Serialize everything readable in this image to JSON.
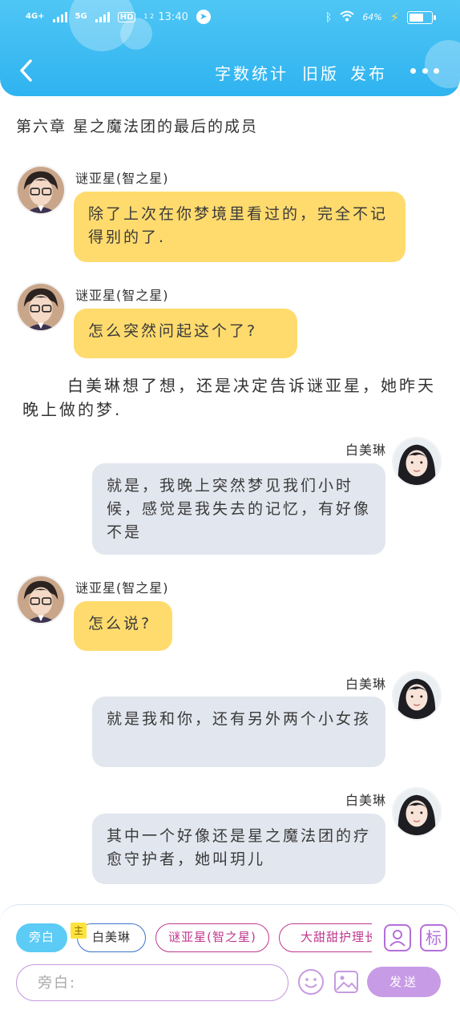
{
  "status_bar": {
    "network_1": "4G+",
    "network_2": "5G",
    "hd_label": "HD",
    "hd_sub": "1 2",
    "time": "13:40",
    "battery_percent": "64%",
    "battery_level": 0.64
  },
  "header": {
    "back_icon": "chevron-left-icon",
    "actions": [
      "字数统计",
      "旧版",
      "发布"
    ],
    "more_icon": "more-dots-icon",
    "accent_color": "#2fb3f0"
  },
  "chapter_title": "第六章 星之魔法团的最后的成员",
  "messages": [
    {
      "speaker": "谜亚星(智之星)",
      "side": "left",
      "text": "除了上次在你梦境里看过的，完全不记得别的了."
    },
    {
      "speaker": "谜亚星(智之星)",
      "side": "left",
      "text": "怎么突然问起这个了?"
    },
    {
      "type": "narration",
      "text": "白美琳想了想，还是决定告诉谜亚星，她昨天晚上做的梦."
    },
    {
      "speaker": "白美琳",
      "side": "right",
      "text": "就是，我晚上突然梦见我们小时候，感觉是我失去的记忆，有好像不是"
    },
    {
      "speaker": "谜亚星(智之星)",
      "side": "left",
      "text": "怎么说?"
    },
    {
      "speaker": "白美琳",
      "side": "right",
      "text": "就是我和你，还有另外两个小女孩"
    },
    {
      "speaker": "白美琳",
      "side": "right",
      "text": "其中一个好像还是星之魔法团的疗愈守护者，她叫玥儿"
    }
  ],
  "bottom_bar": {
    "roles": [
      "旁白",
      "白美琳",
      "谜亚星(智之星)",
      "大甜甜护理长"
    ],
    "main_badge": "主",
    "tag_button": "标",
    "input_placeholder": "旁白:",
    "send_label": "发送",
    "colors": {
      "narrator": "#5ccbf5",
      "role_border": "#c0388e",
      "primary_border": "#3b73c9",
      "send": "#c79be6"
    }
  }
}
